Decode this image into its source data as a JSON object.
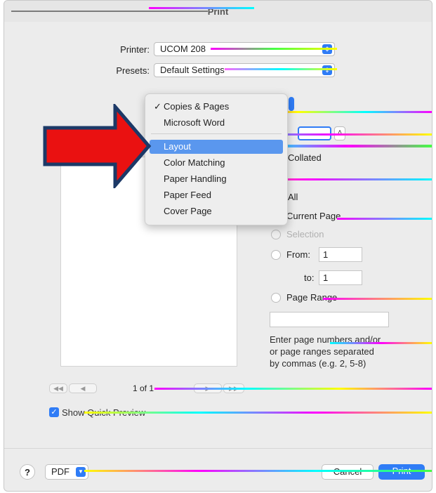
{
  "window": {
    "title": "Print"
  },
  "printer": {
    "label": "Printer:",
    "value": "UCOM 208"
  },
  "presets": {
    "label": "Presets:",
    "value": "Default Settings"
  },
  "section_menu": {
    "items": [
      {
        "label": "Copies & Pages",
        "checked": true
      },
      {
        "label": "Microsoft Word",
        "checked": false
      },
      {
        "label": "Layout",
        "checked": false,
        "selected": true
      },
      {
        "label": "Color Matching",
        "checked": false
      },
      {
        "label": "Paper Handling",
        "checked": false
      },
      {
        "label": "Paper Feed",
        "checked": false
      },
      {
        "label": "Cover Page",
        "checked": false
      }
    ]
  },
  "copies": {
    "collated_label": "Collated"
  },
  "pages": {
    "all_label": "All",
    "current_label": "Current Page",
    "selection_label": "Selection",
    "from_label": "From:",
    "from_value": "1",
    "to_label": "to:",
    "to_value": "1",
    "range_label": "Page Range",
    "range_help": [
      "Enter page numbers and/or",
      "or page ranges separated",
      "by commas (e.g. 2, 5-8)"
    ]
  },
  "preview_nav": {
    "page_status": "1 of 1"
  },
  "quick_preview": {
    "label": "Show Quick Preview",
    "checked": true
  },
  "footer": {
    "help_label": "?",
    "pdf_label": "PDF",
    "cancel_label": "Cancel",
    "print_label": "Print"
  },
  "colors": {
    "accent": "#2f7cf6",
    "highlight": "#5a97ee",
    "arrow": "#ea1111",
    "arrow_border": "#1c3967"
  }
}
